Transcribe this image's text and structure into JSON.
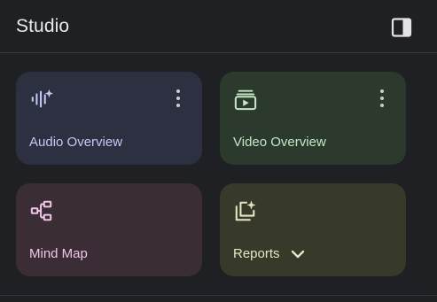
{
  "header": {
    "title": "Studio"
  },
  "cards": [
    {
      "label": "Audio Overview",
      "bg": "#2d3040",
      "fg": "#c4c8f5",
      "icon": "audio-waveform-sparkle-icon"
    },
    {
      "label": "Video Overview",
      "bg": "#2c3a2e",
      "fg": "#c4e8c6",
      "icon": "video-play-icon"
    },
    {
      "label": "Mind Map",
      "bg": "#3a2d35",
      "fg": "#f0c6e6",
      "icon": "mind-map-icon"
    },
    {
      "label": "Reports",
      "bg": "#37392a",
      "fg": "#e8e6c4",
      "icon": "reports-sparkle-icon"
    }
  ]
}
